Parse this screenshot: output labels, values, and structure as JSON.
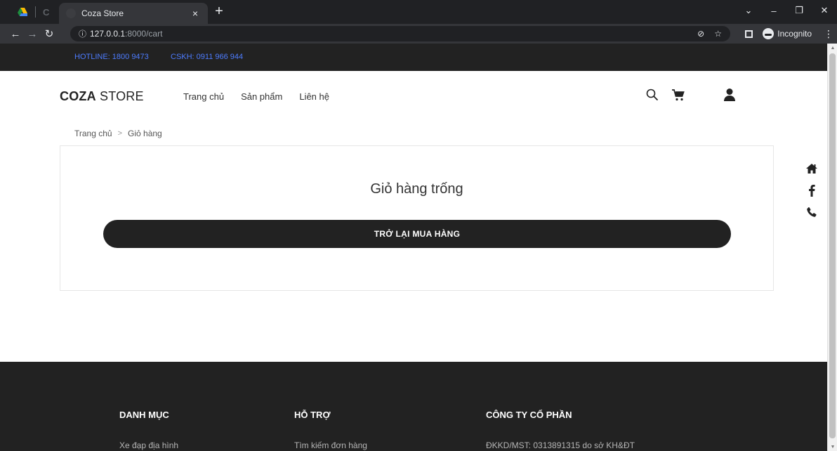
{
  "browser": {
    "tab_title": "Coza Store",
    "tab_close": "×",
    "new_tab": "+",
    "url_host": "127.0.0.1",
    "url_path": ":8000/cart",
    "incognito_label": "Incognito"
  },
  "topbar": {
    "hotline": "HOTLINE: 1800 9473",
    "cskh": "CSKH: 0911 966 944"
  },
  "header": {
    "logo_bold": "COZA",
    "logo_rest": " STORE",
    "menu": [
      "Trang chủ",
      "Sản phẩm",
      "Liên hệ"
    ]
  },
  "breadcrumb": {
    "home": "Trang chủ",
    "separator": ">",
    "current": "Giỏ hàng"
  },
  "cart": {
    "empty_message": "Giỏ hàng trống",
    "back_button": "TRỞ LẠI MUA HÀNG"
  },
  "footer": {
    "columns": [
      {
        "heading": "DANH MỤC",
        "first_item": "Xe đạp địa hình"
      },
      {
        "heading": "HỖ TRỢ",
        "first_item": "Tìm kiếm đơn hàng"
      },
      {
        "heading": "CÔNG TY CỔ PHẦN",
        "first_item": "ĐKKD/MST: 0313891315 do sở KH&ĐT"
      }
    ]
  },
  "colors": {
    "dark": "#222222",
    "hotline_blue": "#4d7cff"
  }
}
